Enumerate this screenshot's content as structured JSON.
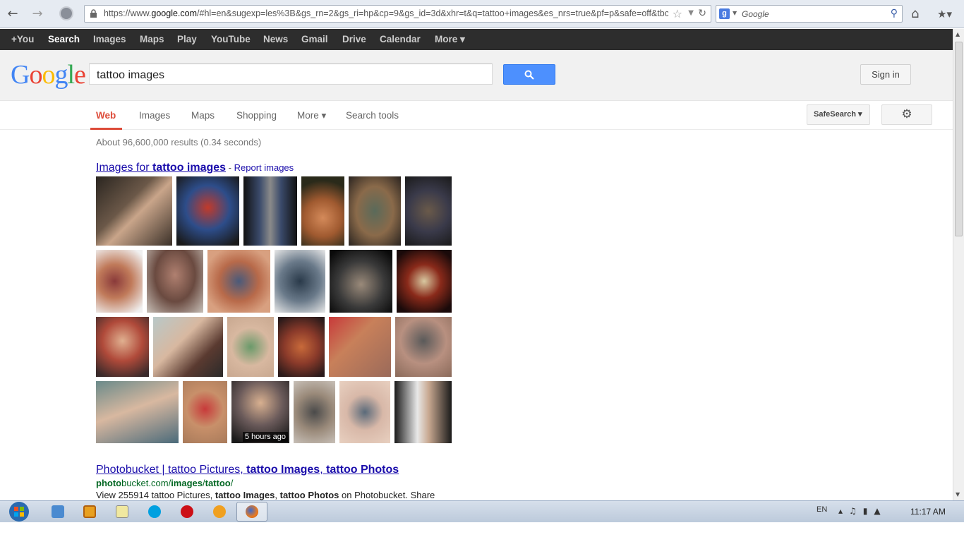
{
  "browser": {
    "url_prefix": "https://www.",
    "url_domain": "google.com",
    "url_rest": "/#hl=en&sugexp=les%3B&gs_rn=2&gs_ri=hp&cp=9&gs_id=3d&xhr=t&q=tattoo+images&es_nrs=true&pf=p&safe=off&tbc",
    "search_placeholder": "Google"
  },
  "gbar": {
    "items": [
      "+You",
      "Search",
      "Images",
      "Maps",
      "Play",
      "YouTube",
      "News",
      "Gmail",
      "Drive",
      "Calendar",
      "More ▾"
    ]
  },
  "header": {
    "query": "tattoo images",
    "sign_in": "Sign in"
  },
  "tabs": {
    "items": [
      "Web",
      "Images",
      "Maps",
      "Shopping",
      "More ▾",
      "Search tools"
    ],
    "safesearch": "SafeSearch ▾"
  },
  "results": {
    "stats": "About 96,600,000 results (0.34 seconds)",
    "images_prefix": "Images for ",
    "images_query": "tattoo images",
    "images_sep": " - ",
    "report": "Report images",
    "thumb_caption": "5 hours ago",
    "result1": {
      "title_a": "Photobucket | tattoo Pictures, ",
      "title_b": "tattoo Images",
      "title_c": ", ",
      "title_d": "tattoo Photos",
      "url_a": "photo",
      "url_b": "bucket.com/",
      "url_c": "images",
      "url_d": "/",
      "url_e": "tattoo",
      "url_f": "/",
      "snippet_a": "View 255914 tattoo Pictures, ",
      "snippet_b": "tattoo Images",
      "snippet_c": ", ",
      "snippet_d": "tattoo Photos",
      "snippet_e": " on Photobucket. Share"
    }
  },
  "taskbar": {
    "lang": "EN",
    "clock": "11:17 AM"
  }
}
